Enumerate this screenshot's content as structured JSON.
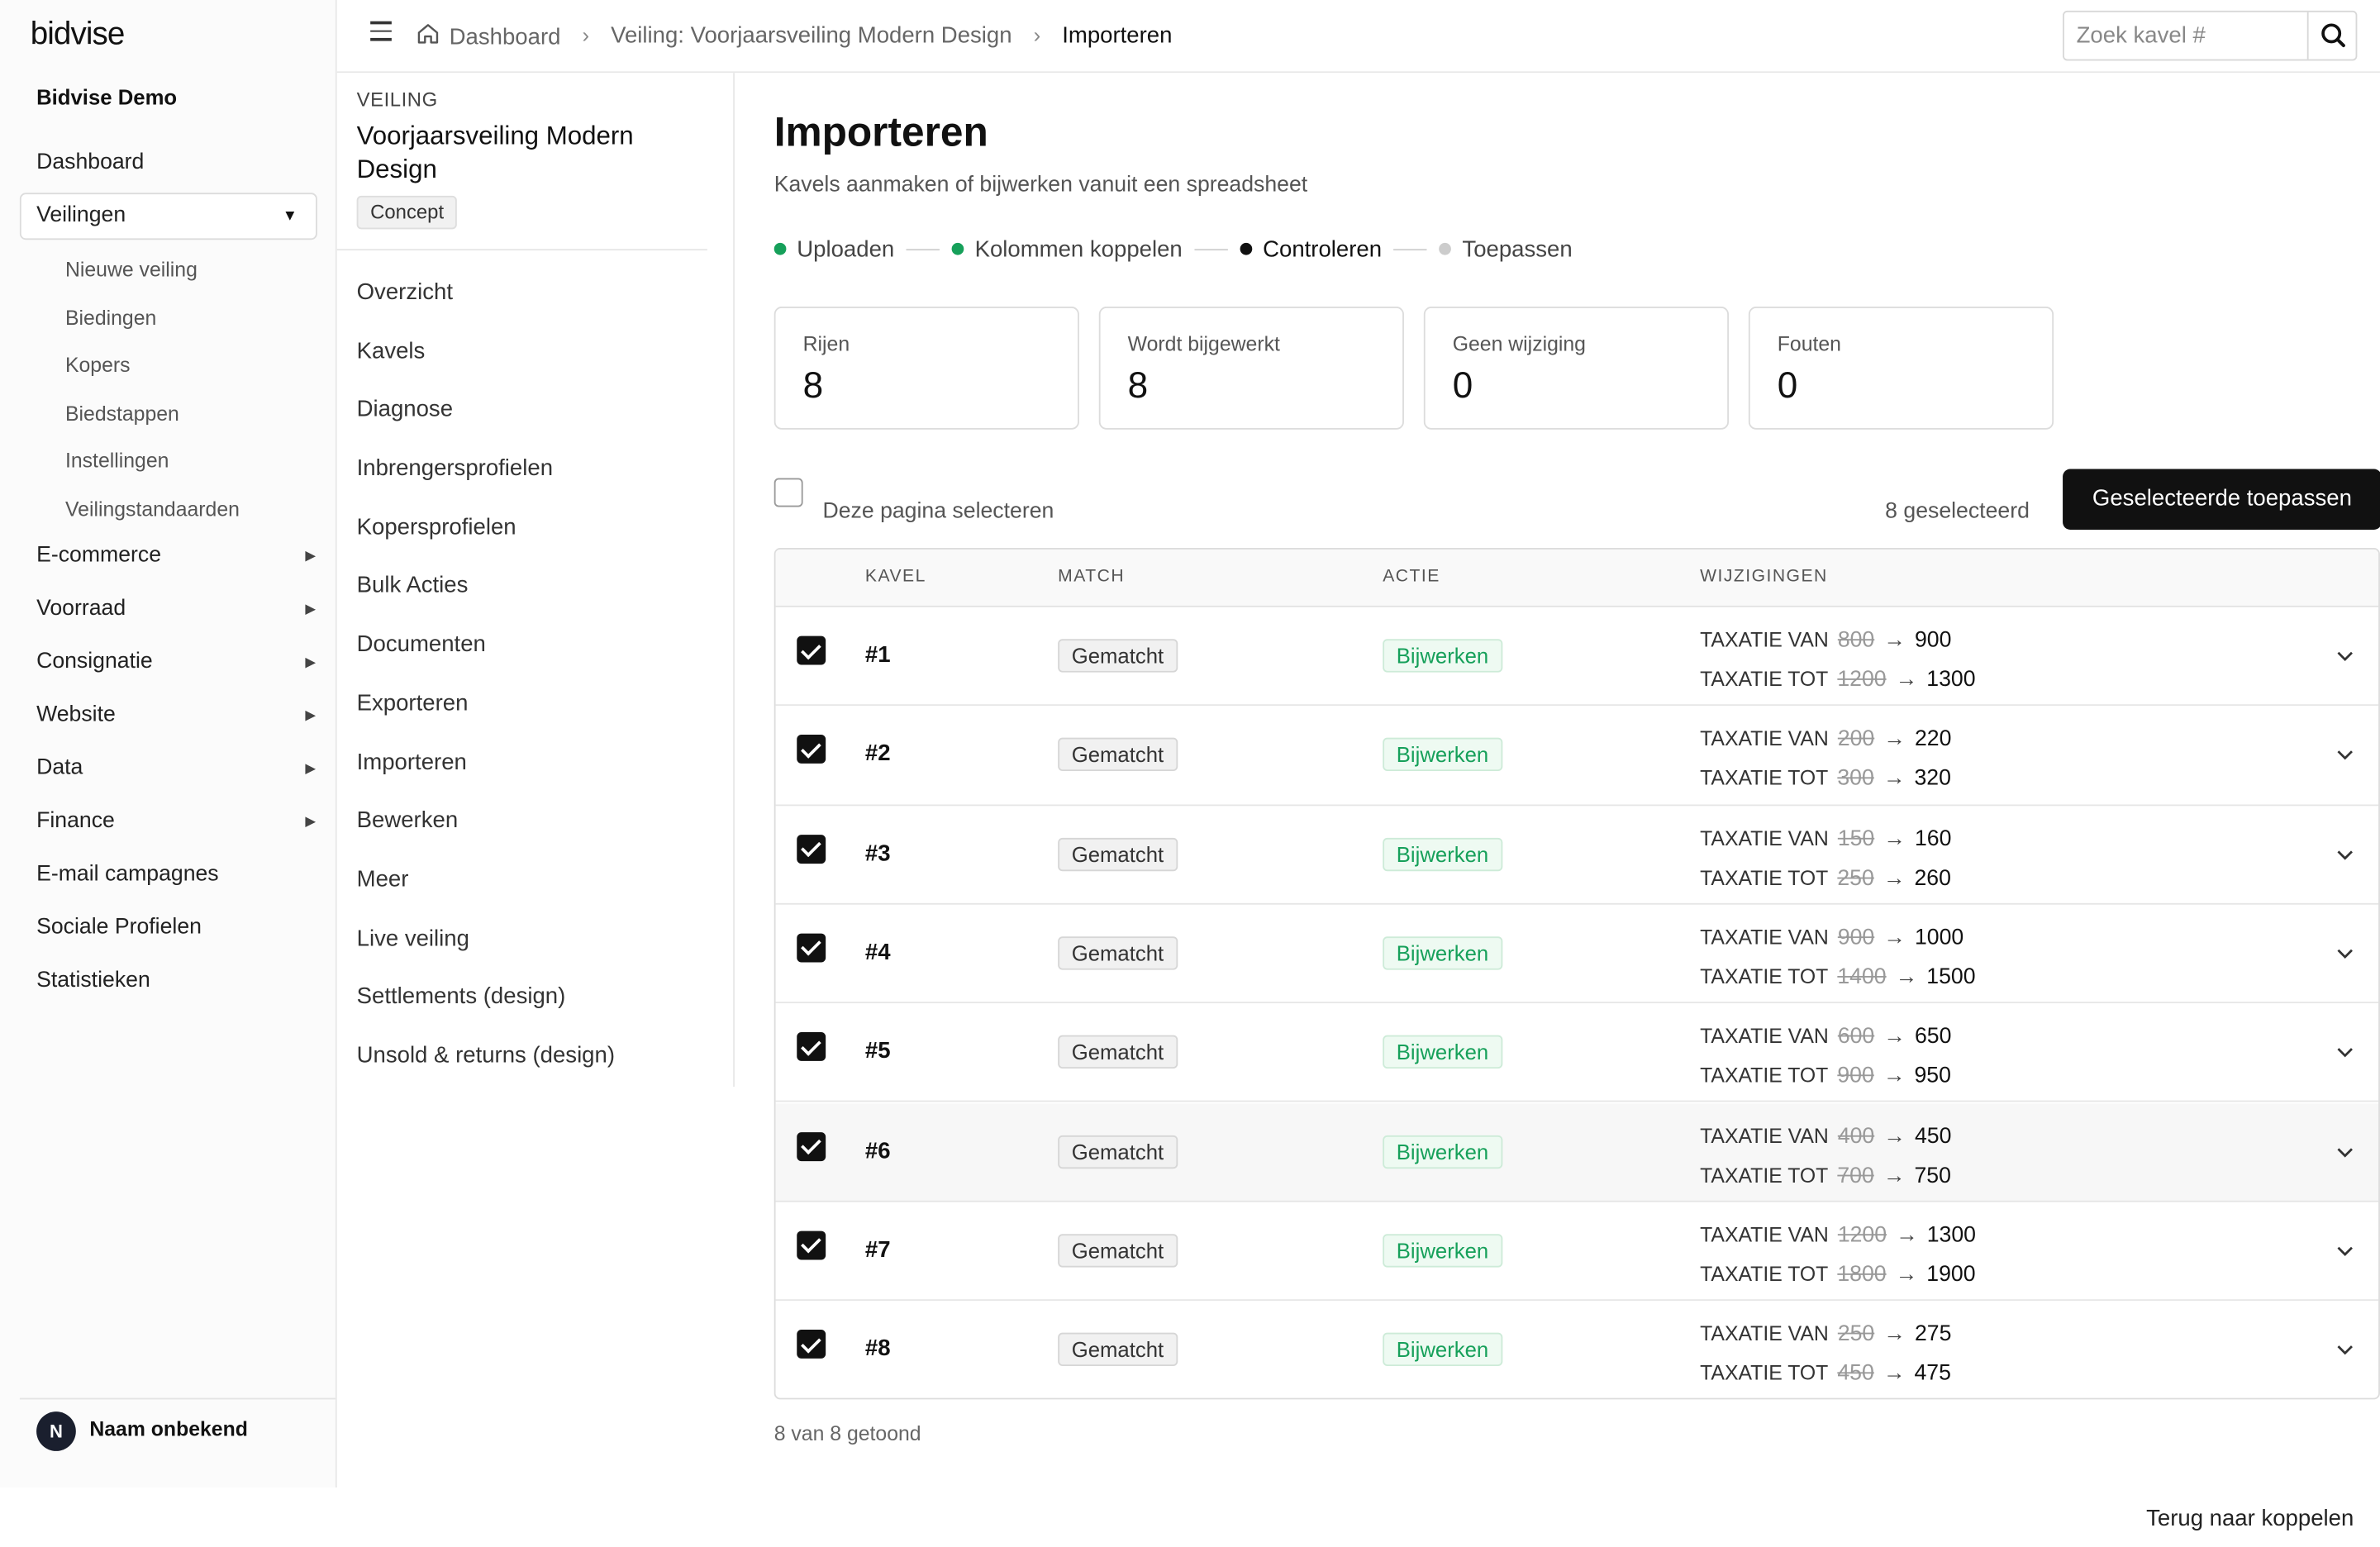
{
  "brand": "bidvise",
  "org_name": "Bidvise Demo",
  "sidebar": {
    "items": [
      {
        "label": "Dashboard"
      },
      {
        "label": "Veilingen"
      },
      {
        "label": "E-commerce"
      },
      {
        "label": "Voorraad"
      },
      {
        "label": "Consignatie"
      },
      {
        "label": "Website"
      },
      {
        "label": "Data"
      },
      {
        "label": "Finance"
      },
      {
        "label": "E-mail campagnes"
      },
      {
        "label": "Sociale Profielen"
      },
      {
        "label": "Statistieken"
      }
    ],
    "sub_items": [
      "Nieuwe veiling",
      "Biedingen",
      "Kopers",
      "Biedstappen",
      "Instellingen",
      "Veilingstandaarden"
    ]
  },
  "user": {
    "initial": "N",
    "name": "Naam onbekend"
  },
  "breadcrumb": {
    "home": "Dashboard",
    "auction": "Veiling: Voorjaarsveiling Modern Design",
    "current": "Importeren"
  },
  "search": {
    "placeholder": "Zoek kavel #"
  },
  "panel": {
    "kicker": "VEILING",
    "title": "Voorjaarsveiling Modern Design",
    "status": "Concept",
    "menu": [
      "Overzicht",
      "Kavels",
      "Diagnose",
      "Inbrengersprofielen",
      "Kopersprofielen",
      "Bulk Acties",
      "Documenten",
      "Exporteren",
      "Importeren",
      "Bewerken",
      "Meer",
      "Live veiling",
      "Settlements (design)",
      "Unsold & returns (design)"
    ]
  },
  "page": {
    "title": "Importeren",
    "subtitle": "Kavels aanmaken of bijwerken vanuit een spreadsheet"
  },
  "steps": [
    {
      "label": "Uploaden",
      "state": "done"
    },
    {
      "label": "Kolommen koppelen",
      "state": "done"
    },
    {
      "label": "Controleren",
      "state": "current"
    },
    {
      "label": "Toepassen",
      "state": "todo"
    }
  ],
  "colors": {
    "done": "#16a05a",
    "current": "#111111",
    "todo": "#cccccc"
  },
  "stats": [
    {
      "label": "Rijen",
      "value": "8"
    },
    {
      "label": "Wordt bijgewerkt",
      "value": "8"
    },
    {
      "label": "Geen wijziging",
      "value": "0"
    },
    {
      "label": "Fouten",
      "value": "0"
    }
  ],
  "selection": {
    "select_page_label": "Deze pagina selecteren",
    "selected_count": "8 geselecteerd",
    "apply_label": "Geselecteerde toepassen"
  },
  "table": {
    "headers": [
      "KAVEL",
      "MATCH",
      "ACTIE",
      "WIJZIGINGEN"
    ],
    "change_labels": {
      "from": "TAXATIE VAN",
      "to": "TAXATIE TOT"
    },
    "rows": [
      {
        "lot": "#1",
        "match": "Gematcht",
        "action": "Bijwerken",
        "from_old": "800",
        "from_new": "900",
        "to_old": "1200",
        "to_new": "1300"
      },
      {
        "lot": "#2",
        "match": "Gematcht",
        "action": "Bijwerken",
        "from_old": "200",
        "from_new": "220",
        "to_old": "300",
        "to_new": "320"
      },
      {
        "lot": "#3",
        "match": "Gematcht",
        "action": "Bijwerken",
        "from_old": "150",
        "from_new": "160",
        "to_old": "250",
        "to_new": "260"
      },
      {
        "lot": "#4",
        "match": "Gematcht",
        "action": "Bijwerken",
        "from_old": "900",
        "from_new": "1000",
        "to_old": "1400",
        "to_new": "1500"
      },
      {
        "lot": "#5",
        "match": "Gematcht",
        "action": "Bijwerken",
        "from_old": "600",
        "from_new": "650",
        "to_old": "900",
        "to_new": "950"
      },
      {
        "lot": "#6",
        "match": "Gematcht",
        "action": "Bijwerken",
        "from_old": "400",
        "from_new": "450",
        "to_old": "700",
        "to_new": "750"
      },
      {
        "lot": "#7",
        "match": "Gematcht",
        "action": "Bijwerken",
        "from_old": "1200",
        "from_new": "1300",
        "to_old": "1800",
        "to_new": "1900"
      },
      {
        "lot": "#8",
        "match": "Gematcht",
        "action": "Bijwerken",
        "from_old": "250",
        "from_new": "275",
        "to_old": "450",
        "to_new": "475"
      }
    ]
  },
  "footer": {
    "shown": "8 van 8 getoond",
    "back": "Terug naar koppelen"
  }
}
